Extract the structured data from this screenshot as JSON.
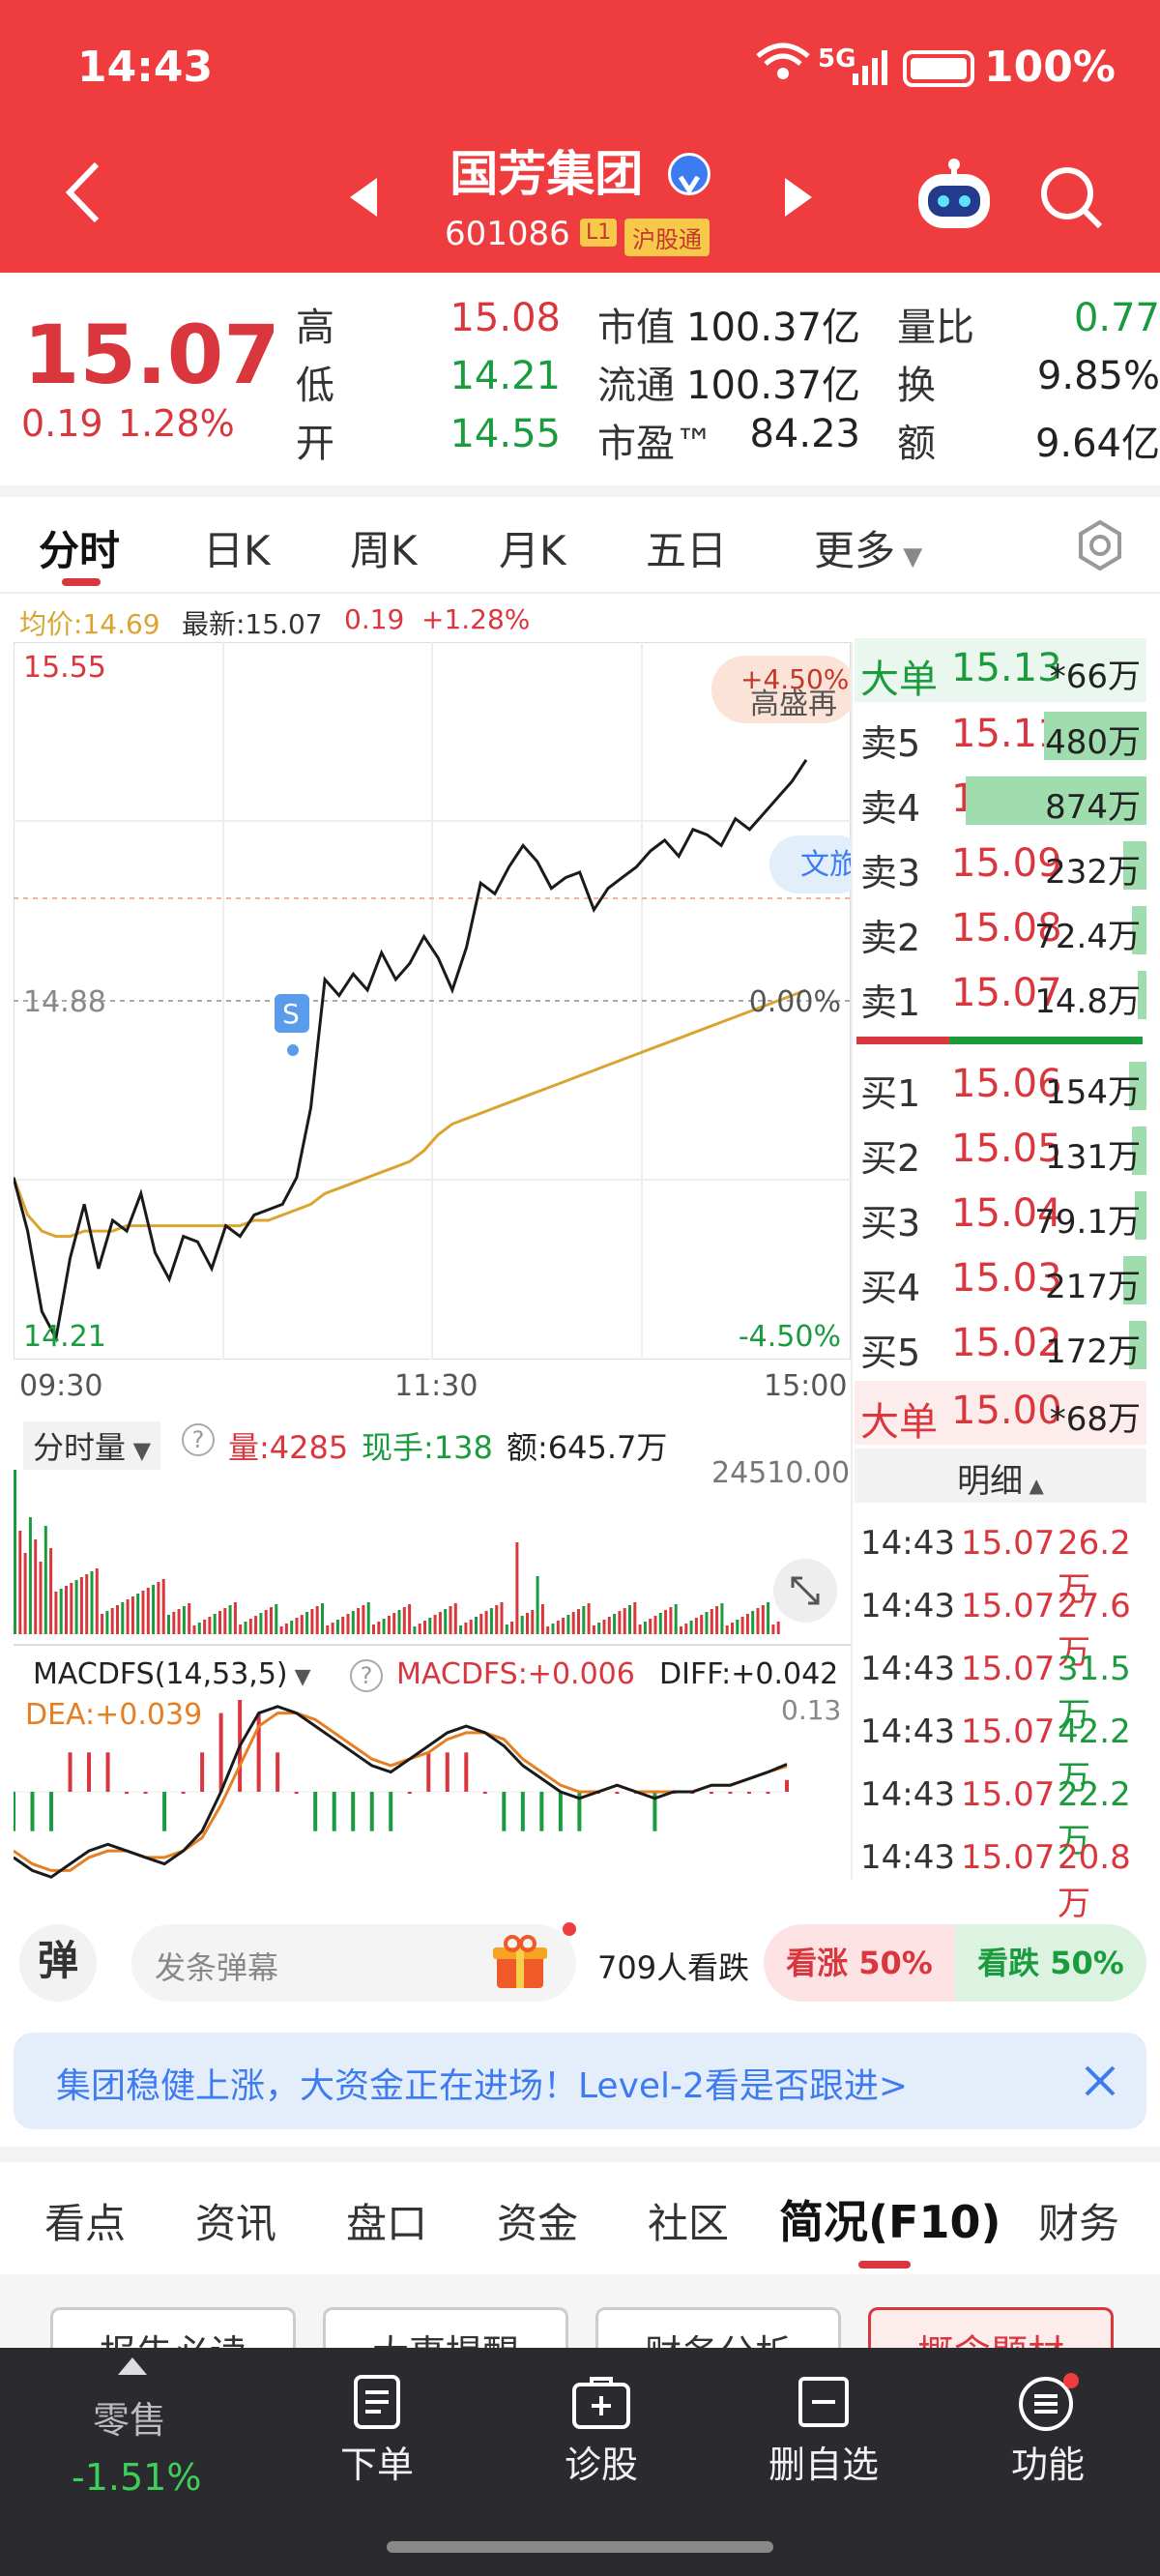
{
  "status": {
    "time": "14:43",
    "network": "5G",
    "battery": "100%"
  },
  "header": {
    "title": "国芳集团",
    "code": "601086",
    "level_badge": "L1",
    "hk_badge": "沪股通"
  },
  "quote": {
    "price": "15.07",
    "change": "0.19",
    "change_pct": "1.28%",
    "high_label": "高",
    "high": "15.08",
    "low_label": "低",
    "low": "14.21",
    "open_label": "开",
    "open": "14.55",
    "mktcap_label": "市值",
    "mktcap": "100.37亿",
    "float_label": "流通",
    "float": "100.37亿",
    "pe_label": "市盈™",
    "pe": "84.23",
    "vr_label": "量比",
    "vr": "0.77",
    "turnover_label": "换",
    "turnover": "9.85%",
    "amount_label": "额",
    "amount": "9.64亿"
  },
  "tabs": [
    "分时",
    "日K",
    "周K",
    "月K",
    "五日",
    "更多"
  ],
  "chart_info": {
    "avg": "均价:14.69",
    "latest": "最新:15.07",
    "chg": "0.19",
    "pct": "+1.28%"
  },
  "chart_data": [
    {
      "type": "line",
      "title": "分时",
      "y_top_label": "15.55",
      "y_mid_label": "14.88",
      "y_bot_label": "14.21",
      "pct_top": "+4.50%",
      "pct_mid": "0.00%",
      "pct_bot": "-4.50%",
      "x_labels": [
        "09:30",
        "11:30",
        "15:00"
      ],
      "ylim": [
        14.21,
        15.55
      ],
      "price": [
        14.55,
        14.45,
        14.3,
        14.25,
        14.4,
        14.5,
        14.38,
        14.47,
        14.45,
        14.52,
        14.41,
        14.36,
        14.44,
        14.43,
        14.38,
        14.46,
        14.44,
        14.48,
        14.49,
        14.5,
        14.55,
        14.68,
        14.92,
        14.89,
        14.93,
        14.9,
        14.97,
        14.92,
        14.95,
        15.0,
        14.96,
        14.9,
        14.98,
        15.1,
        15.08,
        15.13,
        15.17,
        15.14,
        15.09,
        15.11,
        15.12,
        15.05,
        15.09,
        15.11,
        15.13,
        15.16,
        15.18,
        15.15,
        15.2,
        15.19,
        15.17,
        15.22,
        15.2,
        15.23,
        15.26,
        15.29,
        15.33
      ],
      "avg": [
        14.55,
        14.48,
        14.45,
        14.44,
        14.44,
        14.45,
        14.45,
        14.45,
        14.46,
        14.46,
        14.46,
        14.46,
        14.46,
        14.46,
        14.46,
        14.46,
        14.46,
        14.47,
        14.47,
        14.48,
        14.49,
        14.5,
        14.52,
        14.53,
        14.54,
        14.55,
        14.56,
        14.57,
        14.58,
        14.6,
        14.63,
        14.65,
        14.66,
        14.67,
        14.68,
        14.69,
        14.7,
        14.71,
        14.72,
        14.73,
        14.74,
        14.75,
        14.76,
        14.77,
        14.78,
        14.79,
        14.8,
        14.81,
        14.82,
        14.83,
        14.84,
        14.85,
        14.86,
        14.87,
        14.88,
        14.89,
        14.9
      ],
      "annotations": [
        "S",
        "高盛再",
        "文旅"
      ]
    },
    {
      "type": "bar",
      "title": "分时量",
      "max_label": "24510.00",
      "series_labels": {
        "vol": "量:4285",
        "hand": "现手:138",
        "amt": "额:645.7万"
      }
    },
    {
      "type": "line",
      "title": "MACDFS(14,53,5)",
      "series_labels": {
        "macd": "MACDFS:+0.006",
        "diff": "DIFF:+0.042",
        "dea": "DEA:+0.039"
      },
      "max_label": "0.13",
      "diff": [
        -0.1,
        -0.12,
        -0.13,
        -0.11,
        -0.09,
        -0.08,
        -0.09,
        -0.1,
        -0.11,
        -0.09,
        -0.06,
        0.0,
        0.07,
        0.12,
        0.13,
        0.12,
        0.1,
        0.08,
        0.06,
        0.04,
        0.03,
        0.05,
        0.07,
        0.09,
        0.1,
        0.09,
        0.07,
        0.04,
        0.02,
        0.0,
        -0.01,
        0.0,
        0.01,
        0.0,
        -0.01,
        0.0,
        0.0,
        0.01,
        0.01,
        0.02,
        0.03,
        0.042
      ],
      "dea": [
        -0.09,
        -0.11,
        -0.12,
        -0.12,
        -0.1,
        -0.09,
        -0.09,
        -0.1,
        -0.1,
        -0.09,
        -0.07,
        -0.02,
        0.04,
        0.1,
        0.12,
        0.12,
        0.11,
        0.09,
        0.07,
        0.05,
        0.04,
        0.05,
        0.06,
        0.08,
        0.09,
        0.09,
        0.08,
        0.05,
        0.03,
        0.01,
        0.0,
        0.0,
        0.01,
        0.0,
        0.0,
        0.0,
        0.0,
        0.01,
        0.01,
        0.02,
        0.03,
        0.039
      ]
    }
  ],
  "orderbook": {
    "big_sell": {
      "label": "大单",
      "price": "15.13",
      "vol": "*66万"
    },
    "asks": [
      {
        "label": "卖5",
        "price": "15.11",
        "vol": "480万",
        "bar": 0.35
      },
      {
        "label": "卖4",
        "price": "15.10",
        "vol": "874万",
        "bar": 0.62
      },
      {
        "label": "卖3",
        "price": "15.09",
        "vol": "232万",
        "bar": 0.08
      },
      {
        "label": "卖2",
        "price": "15.08",
        "vol": "72.4万",
        "bar": 0.05
      },
      {
        "label": "卖1",
        "price": "15.07",
        "vol": "14.8万",
        "bar": 0.03
      }
    ],
    "bids": [
      {
        "label": "买1",
        "price": "15.06",
        "vol": "154万",
        "bar": 0.06
      },
      {
        "label": "买2",
        "price": "15.05",
        "vol": "131万",
        "bar": 0.05
      },
      {
        "label": "买3",
        "price": "15.04",
        "vol": "79.1万",
        "bar": 0.04
      },
      {
        "label": "买4",
        "price": "15.03",
        "vol": "217万",
        "bar": 0.08
      },
      {
        "label": "买5",
        "price": "15.02",
        "vol": "172万",
        "bar": 0.06
      }
    ],
    "big_buy": {
      "label": "大单",
      "price": "15.00",
      "vol": "*68万"
    },
    "detail_label": "明细",
    "details": [
      {
        "time": "14:43",
        "price": "15.07",
        "vol": "26.2万",
        "color": "red"
      },
      {
        "time": "14:43",
        "price": "15.07",
        "vol": "27.6万",
        "color": "red"
      },
      {
        "time": "14:43",
        "price": "15.07",
        "vol": "31.5万",
        "color": "green"
      },
      {
        "time": "14:43",
        "price": "15.07",
        "vol": "42.2万",
        "color": "green"
      },
      {
        "time": "14:43",
        "price": "15.07",
        "vol": "22.2万",
        "color": "green"
      },
      {
        "time": "14:43",
        "price": "15.07",
        "vol": "20.8万",
        "color": "red"
      }
    ]
  },
  "danmu": {
    "icon": "弹",
    "placeholder": "发条弹幕",
    "watch_count": "709人看跌",
    "up": "看涨 50%",
    "down": "看跌 50%",
    "up_share": 0.5
  },
  "banner": {
    "text": "集团稳健上涨，大资金正在进场！Level-2看是否跟进>"
  },
  "subtabs": [
    "看点",
    "资讯",
    "盘口",
    "资金",
    "社区",
    "简况(F10)",
    "财务"
  ],
  "subtab_active": 5,
  "peek_buttons": [
    "报告必读",
    "大事提醒",
    "财务分析",
    "概念题材"
  ],
  "bottomnav": {
    "retail_label": "零售",
    "retail_value": "-1.51%",
    "items": [
      "下单",
      "诊股",
      "删自选",
      "功能"
    ]
  },
  "colors": {
    "red": "#ee3c3f",
    "rise": "#d9363e",
    "fall": "#1a9b3e",
    "avg": "#d9a530"
  }
}
